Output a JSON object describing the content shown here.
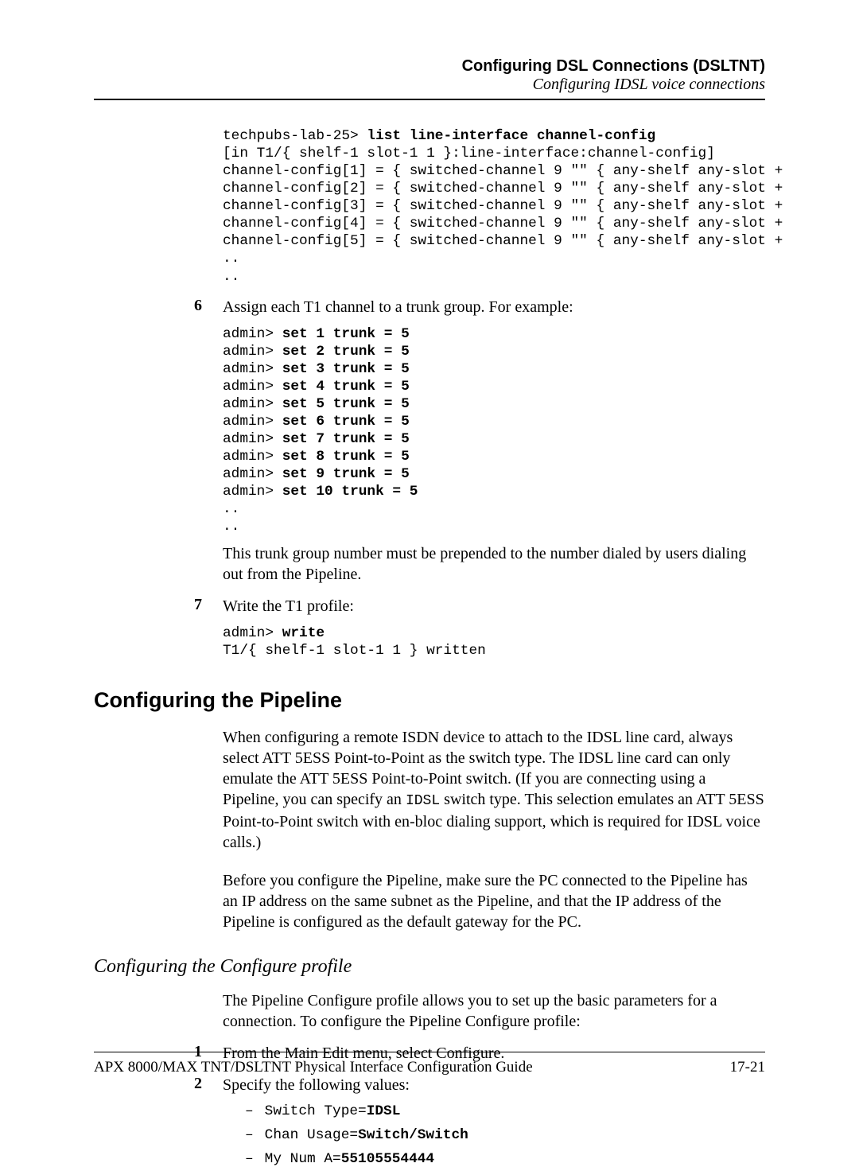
{
  "header": {
    "bold": "Configuring DSL Connections (DSLTNT)",
    "italic": "Configuring IDSL voice connections"
  },
  "code_block_1": {
    "line1_prefix": "techpubs-lab-25> ",
    "line1_bold": "list line-interface channel-config",
    "lines_after": "[in T1/{ shelf-1 slot-1 1 }:line-interface:channel-config]\nchannel-config[1] = { switched-channel 9 \"\" { any-shelf any-slot +\nchannel-config[2] = { switched-channel 9 \"\" { any-shelf any-slot +\nchannel-config[3] = { switched-channel 9 \"\" { any-shelf any-slot +\nchannel-config[4] = { switched-channel 9 \"\" { any-shelf any-slot +\nchannel-config[5] = { switched-channel 9 \"\" { any-shelf any-slot +\n..\n.."
  },
  "step6": {
    "num": "6",
    "text": "Assign each T1 channel to a trunk group. For example:"
  },
  "code_block_2": {
    "prefix": "admin> ",
    "lines": [
      "set 1 trunk = 5",
      "set 2 trunk = 5",
      "set 3 trunk = 5",
      "set 4 trunk = 5",
      "set 5 trunk = 5",
      "set 6 trunk = 5",
      "set 7 trunk = 5",
      "set 8 trunk = 5",
      "set 9 trunk = 5",
      "set 10 trunk = 5"
    ],
    "trailing": "..\n.."
  },
  "trunk_note": "This trunk group number must be prepended to the number dialed by users dialing out from the Pipeline.",
  "step7": {
    "num": "7",
    "text": "Write the T1 profile:"
  },
  "code_block_3": {
    "line1_prefix": "admin> ",
    "line1_bold": "write",
    "line2": "T1/{ shelf-1 slot-1 1 } written"
  },
  "section": {
    "title": "Configuring the Pipeline",
    "para1_a": "When configuring a remote ISDN device to attach to the IDSL line card, always select ATT 5ESS Point-to-Point as the switch type. The IDSL line card can only emulate the ATT 5ESS Point-to-Point switch. (If you are connecting using a Pipeline, you can specify an ",
    "para1_mono": "IDSL",
    "para1_b": " switch type. This selection emulates an ATT 5ESS Point-to-Point switch with en-bloc dialing support, which is required for IDSL voice calls.)",
    "para2": "Before you configure the Pipeline, make sure the PC connected to the Pipeline has an IP address on the same subnet as the Pipeline, and that the IP address of the Pipeline is configured as the default gateway for the PC."
  },
  "subsection": {
    "title": "Configuring the Configure profile",
    "intro": "The Pipeline Configure profile allows you to set up the basic parameters for a connection. To configure the Pipeline Configure profile:",
    "step1": {
      "num": "1",
      "text": "From the Main Edit menu, select Configure."
    },
    "step2": {
      "num": "2",
      "text": "Specify the following values:"
    },
    "items": [
      {
        "label": "Switch Type=",
        "value": "IDSL"
      },
      {
        "label": "Chan Usage=",
        "value": "Switch/Switch"
      },
      {
        "label": "My Num A=",
        "value": "55105554444"
      }
    ]
  },
  "footer": {
    "left": "APX 8000/MAX TNT/DSLTNT Physical Interface Configuration Guide",
    "right": "17-21"
  }
}
